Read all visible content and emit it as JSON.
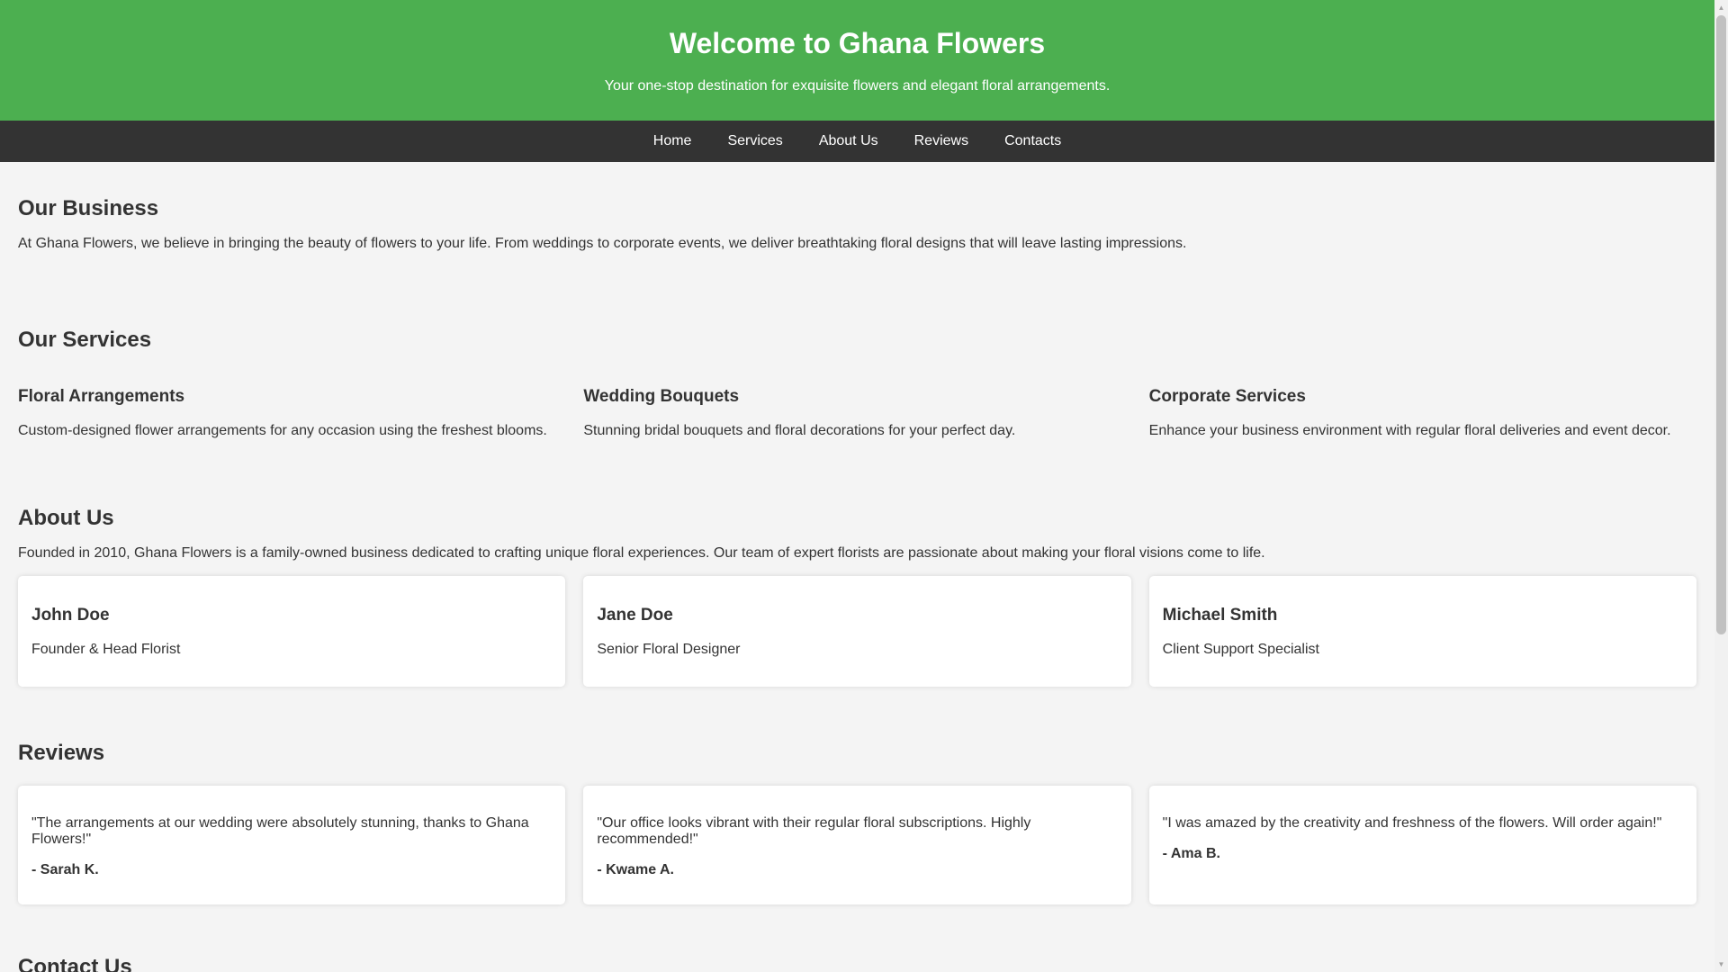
{
  "hero": {
    "title": "Welcome to Ghana Flowers",
    "subtitle": "Your one-stop destination for exquisite flowers and elegant floral arrangements."
  },
  "nav": {
    "items": [
      {
        "label": "Home"
      },
      {
        "label": "Services"
      },
      {
        "label": "About Us"
      },
      {
        "label": "Reviews"
      },
      {
        "label": "Contacts"
      }
    ]
  },
  "business": {
    "heading": "Our Business",
    "text": "At Ghana Flowers, we believe in bringing the beauty of flowers to your life. From weddings to corporate events, we deliver breathtaking floral designs that will leave lasting impressions."
  },
  "services": {
    "heading": "Our Services",
    "items": [
      {
        "title": "Floral Arrangements",
        "text": "Custom-designed flower arrangements for any occasion using the freshest blooms."
      },
      {
        "title": "Wedding Bouquets",
        "text": "Stunning bridal bouquets and floral decorations for your perfect day."
      },
      {
        "title": "Corporate Services",
        "text": "Enhance your business environment with regular floral deliveries and event decor."
      }
    ]
  },
  "about": {
    "heading": "About Us",
    "text": "Founded in 2010, Ghana Flowers is a family-owned business dedicated to crafting unique floral experiences. Our team of expert florists are passionate about making your floral visions come to life.",
    "team": [
      {
        "name": "John Doe",
        "role": "Founder & Head Florist"
      },
      {
        "name": "Jane Doe",
        "role": "Senior Floral Designer"
      },
      {
        "name": "Michael Smith",
        "role": "Client Support Specialist"
      }
    ]
  },
  "reviews": {
    "heading": "Reviews",
    "items": [
      {
        "quote": "\"The arrangements at our wedding were absolutely stunning, thanks to Ghana Flowers!\"",
        "author": "- Sarah K."
      },
      {
        "quote": "\"Our office looks vibrant with their regular floral subscriptions. Highly recommended!\"",
        "author": "- Kwame A."
      },
      {
        "quote": "\"I was amazed by the creativity and freshness of the flowers. Will order again!\"",
        "author": "- Ama B."
      }
    ]
  },
  "contact": {
    "heading": "Contact Us"
  },
  "scrollbar": {
    "up_icon": "triangle-up-icon",
    "down_icon": "triangle-down-icon"
  },
  "colors": {
    "hero_bg": "#4caf50",
    "nav_bg": "#333333",
    "page_bg": "#f4f4f4",
    "card_bg": "#ffffff"
  }
}
